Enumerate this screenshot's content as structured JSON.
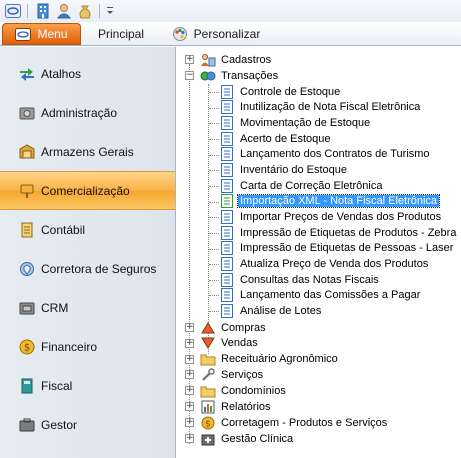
{
  "quick_access": {
    "icons": [
      "app-logo-icon",
      "building-icon",
      "user-icon",
      "money-bag-icon",
      "customize-dropdown-icon"
    ]
  },
  "ribbon": {
    "tabs": [
      {
        "label": "Menu",
        "active": true,
        "icon": "window-icon"
      },
      {
        "label": "Principal",
        "active": false
      },
      {
        "label": "Personalizar",
        "active": false,
        "icon": "palette-icon"
      }
    ]
  },
  "sidebar": {
    "items": [
      {
        "label": "Atalhos",
        "icon": "shortcut-arrows-icon",
        "active": false
      },
      {
        "label": "Administração",
        "icon": "gear-box-icon",
        "active": false
      },
      {
        "label": "Armazens Gerais",
        "icon": "warehouse-box-icon",
        "active": false
      },
      {
        "label": "Comercialização",
        "icon": "sign-icon",
        "active": true
      },
      {
        "label": "Contábil",
        "icon": "ledger-icon",
        "active": false
      },
      {
        "label": "Corretora de Seguros",
        "icon": "insurance-icon",
        "active": false
      },
      {
        "label": "CRM",
        "icon": "crm-box-icon",
        "active": false
      },
      {
        "label": "Financeiro",
        "icon": "coin-icon",
        "active": false
      },
      {
        "label": "Fiscal",
        "icon": "fiscal-book-icon",
        "active": false
      },
      {
        "label": "Gestor",
        "icon": "manager-icon",
        "active": false
      }
    ],
    "active_color": "#f9b347"
  },
  "tree": {
    "top_nodes_before": [
      {
        "label": "Cadastros",
        "icon": "people-tools-icon",
        "expanded": false
      }
    ],
    "transacoes": {
      "label": "Transações",
      "icon": "transactions-icon",
      "expanded": true,
      "children": [
        {
          "label": "Controle de Estoque",
          "selected": false
        },
        {
          "label": "Inutilização de Nota Fiscal Eletrônica",
          "selected": false
        },
        {
          "label": "Movimentação de Estoque",
          "selected": false
        },
        {
          "label": "Acerto de Estoque",
          "selected": false
        },
        {
          "label": "Lançamento dos Contratos de Turismo",
          "selected": false
        },
        {
          "label": "Inventário do Estoque",
          "selected": false
        },
        {
          "label": "Carta de Correção Eletrônica",
          "selected": false
        },
        {
          "label": "Importação XML - Nota Fiscal Eletrônica",
          "selected": true
        },
        {
          "label": "Importar Preços de Vendas dos Produtos",
          "selected": false
        },
        {
          "label": "Impressão de Etiquetas de Produtos - Zebra",
          "selected": false
        },
        {
          "label": "Impressão de Etiquetas de Pessoas - Laser",
          "selected": false
        },
        {
          "label": "Atualiza Preço de Venda dos Produtos",
          "selected": false
        },
        {
          "label": "Consultas das Notas Fiscais",
          "selected": false
        },
        {
          "label": "Lançamento das Comissões a Pagar",
          "selected": false
        },
        {
          "label": "Análise de Lotes",
          "selected": false
        }
      ]
    },
    "top_nodes_after": [
      {
        "label": "Compras",
        "icon": "purchases-icon"
      },
      {
        "label": "Vendas",
        "icon": "sales-icon"
      },
      {
        "label": "Receituário Agronômico",
        "icon": "folder-icon"
      },
      {
        "label": "Serviços",
        "icon": "wrench-icon"
      },
      {
        "label": "Condomínios",
        "icon": "folder-icon"
      },
      {
        "label": "Relatórios",
        "icon": "reports-icon"
      },
      {
        "label": "Corretagem - Produtos e Serviços",
        "icon": "coin-icon"
      },
      {
        "label": "Gestão Clínica",
        "icon": "clinic-icon"
      }
    ],
    "selection_color": "#3399ff"
  }
}
